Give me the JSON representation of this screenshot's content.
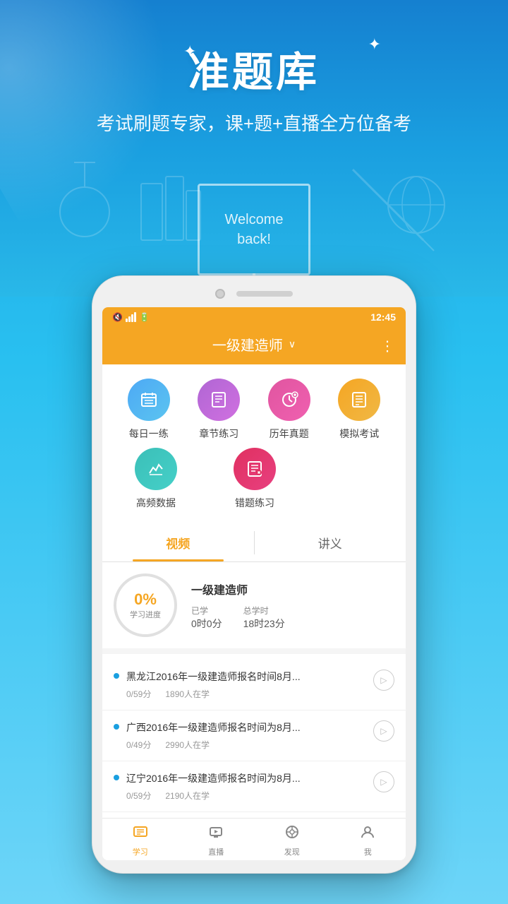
{
  "app": {
    "title": "准题库",
    "subtitle": "考试刷题专家，课+题+直播全方位备考",
    "welcome_text": "Welcome\nback!"
  },
  "status_bar": {
    "time": "12:45"
  },
  "header": {
    "title": "一级建造师",
    "menu_icon": "⋮"
  },
  "grid_items": [
    {
      "id": "daily",
      "label": "每日一练",
      "icon": "📅",
      "color_class": "icon-blue"
    },
    {
      "id": "chapter",
      "label": "章节练习",
      "icon": "📋",
      "color_class": "icon-purple"
    },
    {
      "id": "history",
      "label": "历年真题",
      "icon": "🕐",
      "color_class": "icon-pink"
    },
    {
      "id": "mock",
      "label": "模拟考试",
      "icon": "📄",
      "color_class": "icon-orange"
    },
    {
      "id": "highfreq",
      "label": "高频数据",
      "icon": "📊",
      "color_class": "icon-teal"
    },
    {
      "id": "wrong",
      "label": "错题练习",
      "icon": "📝",
      "color_class": "icon-red"
    }
  ],
  "tabs": [
    {
      "id": "video",
      "label": "视频",
      "active": true
    },
    {
      "id": "handout",
      "label": "讲义",
      "active": false
    }
  ],
  "progress": {
    "percent": "0%",
    "label": "学习进度",
    "course_title": "一级建造师",
    "studied_label": "已学",
    "studied_value": "0时0分",
    "total_label": "总学时",
    "total_value": "18时23分"
  },
  "video_list": [
    {
      "title": "黑龙江2016年一级建造师报名时间8月...",
      "duration": "0/59分",
      "students": "1890人在学"
    },
    {
      "title": "广西2016年一级建造师报名时间为8月...",
      "duration": "0/49分",
      "students": "2990人在学"
    },
    {
      "title": "辽宁2016年一级建造师报名时间为8月...",
      "duration": "0/59分",
      "students": "2190人在学"
    }
  ],
  "bottom_nav": [
    {
      "id": "study",
      "label": "学习",
      "icon": "📚",
      "active": true
    },
    {
      "id": "live",
      "label": "直播",
      "icon": "📺",
      "active": false
    },
    {
      "id": "discover",
      "label": "发现",
      "icon": "🔍",
      "active": false
    },
    {
      "id": "me",
      "label": "我",
      "icon": "👤",
      "active": false
    }
  ]
}
